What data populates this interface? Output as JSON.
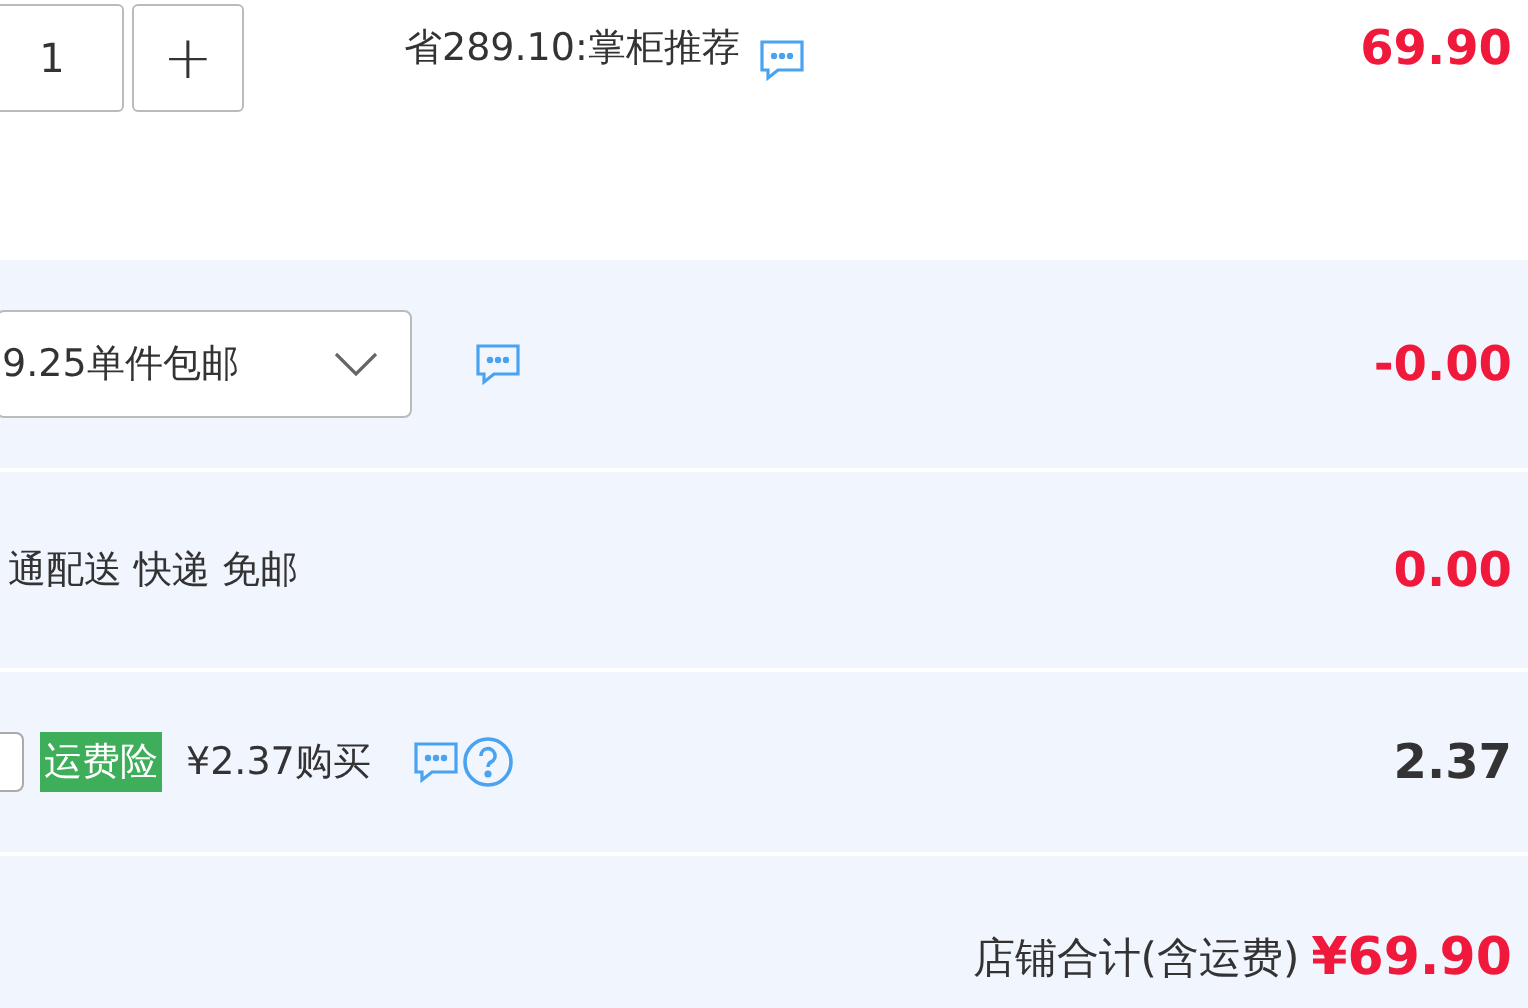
{
  "item": {
    "quantity": "1",
    "plus": "+",
    "promo": "省289.10:掌柜推荐",
    "price": "69.90"
  },
  "rows": [
    {
      "kind": "select",
      "value": "9.25单件包邮",
      "amount": "-0.00",
      "amount_red": true
    },
    {
      "kind": "text",
      "value": "通配送 快递 免邮",
      "amount": "0.00",
      "amount_red": true
    },
    {
      "kind": "insurance",
      "checked": false,
      "badge": "运费险",
      "value": "¥2.37购买",
      "amount": "2.37",
      "amount_red": false
    }
  ],
  "total": {
    "label": "店铺合计(含运费)",
    "value": "¥69.90"
  }
}
